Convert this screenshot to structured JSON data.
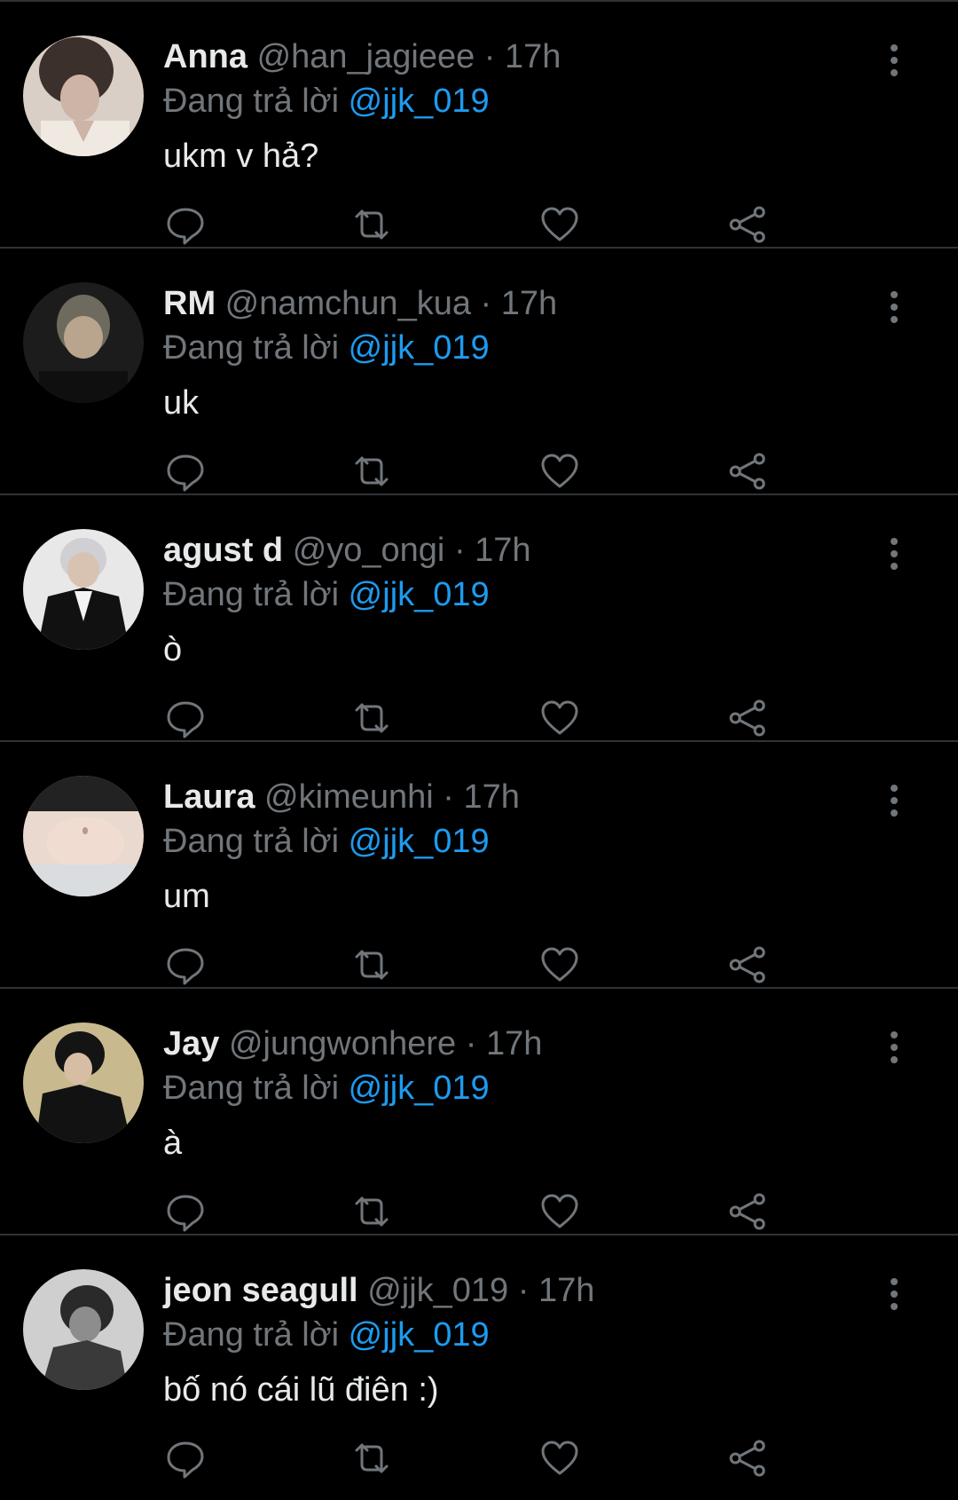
{
  "colors": {
    "background": "#000000",
    "text": "#e7e9ea",
    "muted": "#71767b",
    "accent": "#1d9bf0",
    "divider": "#2f3336"
  },
  "reply_label": "Đang trả lời",
  "icons": {
    "reply": "comment-icon",
    "retweet": "retweet-icon",
    "like": "heart-icon",
    "share": "share-icon",
    "more": "more-vertical-icon"
  },
  "tweets": [
    {
      "name": "Anna",
      "handle": "@han_jagieee",
      "time": "17h",
      "reply_to": "@jjk_019",
      "text": "ukm v hả?"
    },
    {
      "name": "RM",
      "handle": "@namchun_kua",
      "time": "17h",
      "reply_to": "@jjk_019",
      "text": "uk"
    },
    {
      "name": "agust d",
      "handle": "@yo_ongi",
      "time": "17h",
      "reply_to": "@jjk_019",
      "text": "ò"
    },
    {
      "name": "Laura",
      "handle": "@kimeunhi",
      "time": "17h",
      "reply_to": "@jjk_019",
      "text": "um"
    },
    {
      "name": "Jay",
      "handle": "@jungwonhere",
      "time": "17h",
      "reply_to": "@jjk_019",
      "text": "à"
    },
    {
      "name": "jeon seagull",
      "handle": "@jjk_019",
      "time": "17h",
      "reply_to": "@jjk_019",
      "text": "bố nó cái lũ điên :)"
    }
  ]
}
